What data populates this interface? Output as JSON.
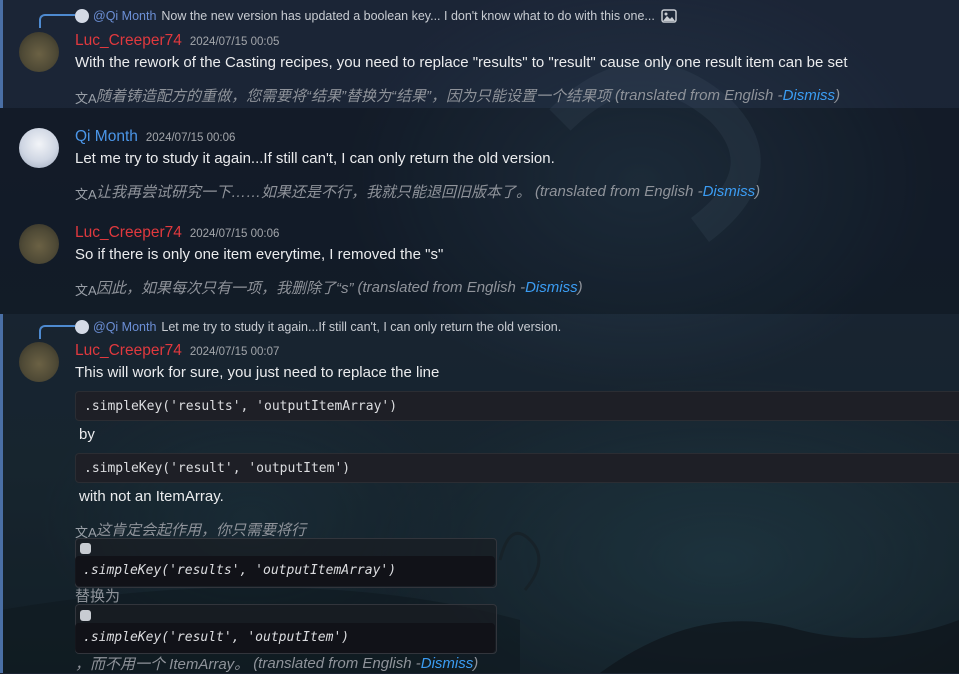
{
  "messages": [
    {
      "reply": {
        "user": "@Qi Month",
        "text": "Now the new version has updated a boolean key... I don't know what to do with this one..."
      },
      "author": "Luc_Creeper74",
      "timestamp": "2024/07/15 00:05",
      "text": "With the rework of the Casting recipes, you need to replace \"results\" to \"result\" cause only one result item can be set",
      "translation": "随着铸造配方的重做，您需要将“结果”替换为“结果”，因为只能设置一个结果项",
      "translation_note": "(translated from English - ",
      "dismiss": "Dismiss",
      "close": ")"
    },
    {
      "author": "Qi Month",
      "timestamp": "2024/07/15 00:06",
      "text": "Let me try to study it again...If still can't, I can only return the old version.",
      "translation": "让我再尝试研究一下……如果还是不行，我就只能退回旧版本了。",
      "translation_note": "(translated from English - ",
      "dismiss": "Dismiss",
      "close": ")"
    },
    {
      "author": "Luc_Creeper74",
      "timestamp": "2024/07/15 00:06",
      "text": "So if there is only one item everytime, I removed the \"s\"",
      "translation": "因此，如果每次只有一项，我删除了“s”",
      "translation_note": "(translated from English - ",
      "dismiss": "Dismiss",
      "close": ")"
    },
    {
      "reply": {
        "user": "@Qi Month",
        "text": "Let me try to study it again...If still can't, I can only return the old version."
      },
      "author": "Luc_Creeper74",
      "timestamp": "2024/07/15 00:07",
      "text": "This will work for sure, you just need to replace the line",
      "code1": ".simpleKey('results', 'outputItemArray')",
      "between": "by",
      "code2": ".simpleKey('result', 'outputItem')",
      "after": "with not an ItemArray.",
      "translation": "这肯定会起作用，你只需要将行",
      "tcode1": ".simpleKey('results', 'outputItemArray')",
      "tbetween": "替换为",
      "tcode2": ".simpleKey('result', 'outputItem')",
      "tafter": "，而不用一个 ItemArray。",
      "translation_note": "(translated from English - ",
      "dismiss": "Dismiss",
      "close": ")"
    }
  ],
  "icons": {
    "reply_image": "image-icon",
    "translate": "translate-icon",
    "copy": "copy-icon"
  }
}
